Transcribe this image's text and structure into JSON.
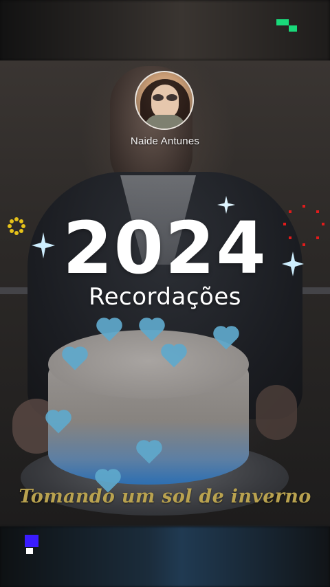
{
  "profile": {
    "name": "Naide Antunes"
  },
  "headline": {
    "year": "2024",
    "subtitle": "Recordações"
  },
  "caption": "Tomando um sol de inverno",
  "icons": {
    "top_right_logo": "green-pixel-logo-icon",
    "bottom_left_logo": "blue-pixel-logo-icon",
    "sparkle": "sparkle-icon",
    "yellow_ring": "yellow-dot-ring-icon",
    "red_ring": "red-dot-ring-icon"
  },
  "colors": {
    "caption": "#b9a24f",
    "top_logo": "#19d97a",
    "bottom_logo": "#3a1cff",
    "sparkle": "#cfefff",
    "yellow_ring": "#e6c21a",
    "red_ring": "#e11b1b"
  }
}
